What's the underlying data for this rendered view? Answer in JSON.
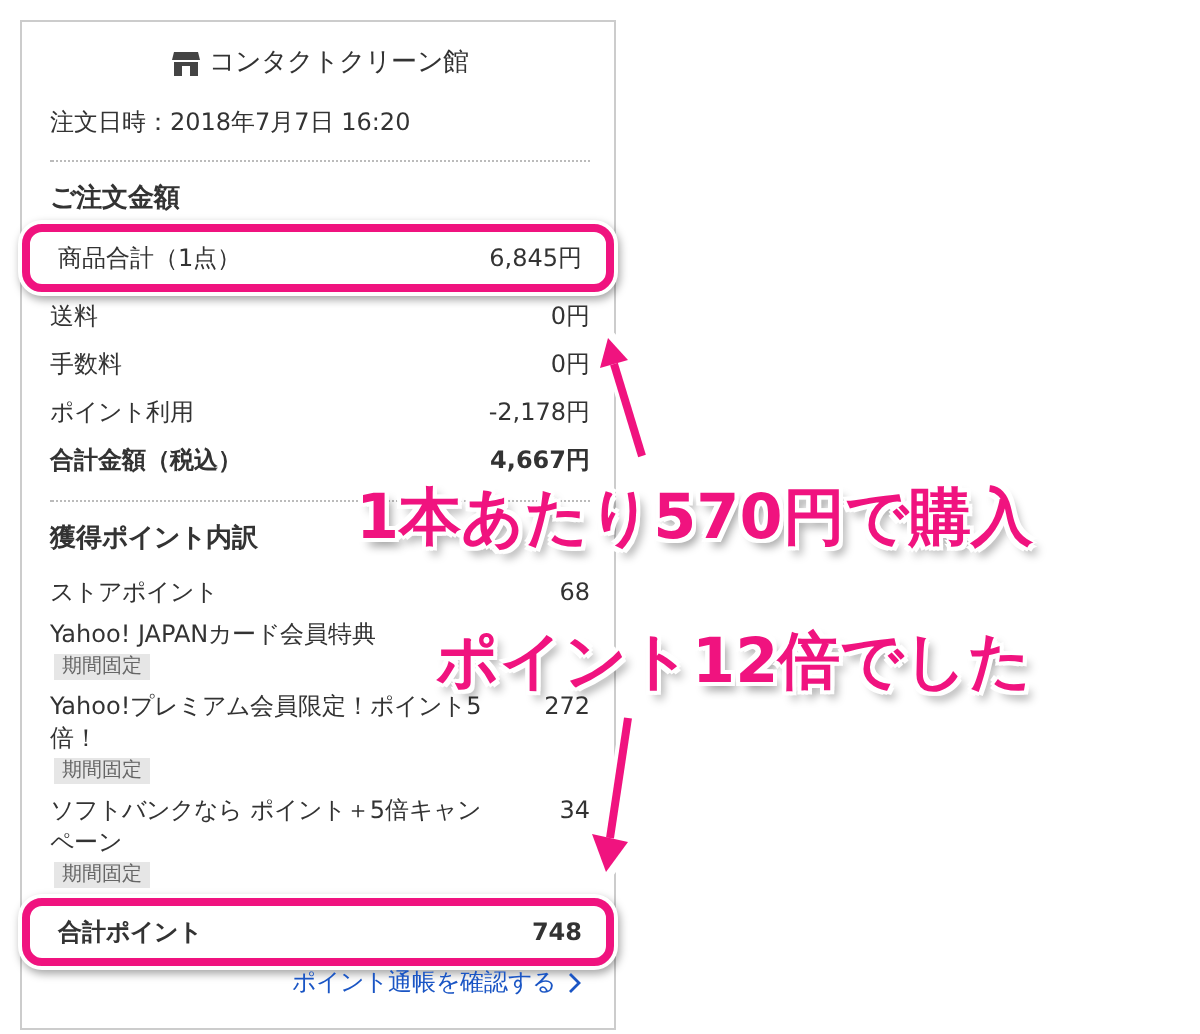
{
  "shop": {
    "name": "コンタクトクリーン館"
  },
  "order_date": "注文日時：2018年7月7日 16:20",
  "order_amount": {
    "heading": "ご注文金額",
    "rows": [
      {
        "label": "商品合計（1点）",
        "value": "6,845円",
        "highlighted": true
      },
      {
        "label": "送料",
        "value": "0円",
        "highlighted": false
      },
      {
        "label": "手数料",
        "value": "0円",
        "highlighted": false
      },
      {
        "label": "ポイント利用",
        "value": "-2,178円",
        "highlighted": false
      }
    ],
    "total": {
      "label": "合計金額（税込）",
      "value": "4,667円"
    }
  },
  "points": {
    "heading": "獲得ポイント内訳",
    "rows": [
      {
        "label": "ストアポイント",
        "value": "68"
      },
      {
        "label": "Yahoo! JAPANカード会員特典",
        "tag": "期間固定"
      },
      {
        "label": "Yahoo!プレミアム会員限定！ポイント5倍！",
        "value": "272",
        "tag": "期間固定"
      },
      {
        "label": "ソフトバンクなら ポイント＋5倍キャンペーン",
        "value": "34",
        "tag": "期間固定"
      }
    ],
    "total": {
      "label": "合計ポイント",
      "value": "748",
      "highlighted": true
    },
    "link": "ポイント通帳を確認する"
  },
  "annotations": [
    {
      "text": "1本あたり570円で購入"
    },
    {
      "text": "ポイント12倍でした"
    }
  ]
}
